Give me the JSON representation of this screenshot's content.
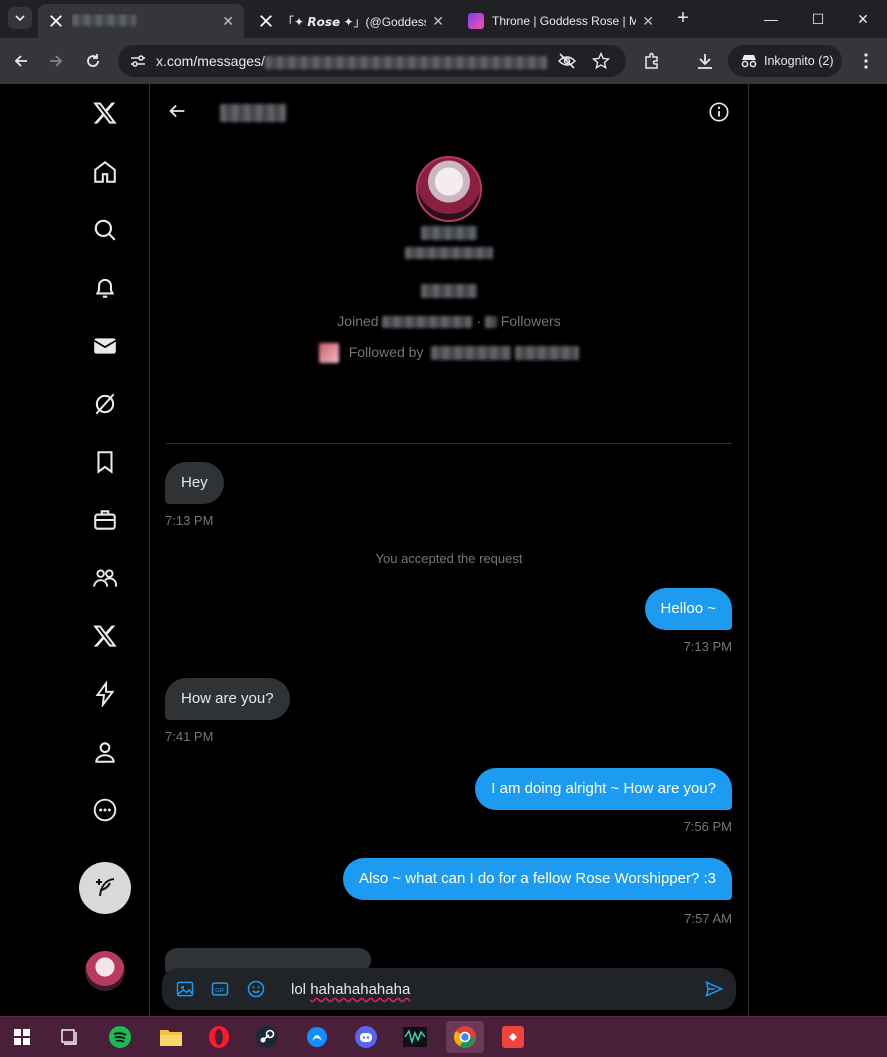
{
  "browser": {
    "tabs": [
      {
        "title": "",
        "active": true
      },
      {
        "title": "「✦ 𝙍𝙤𝙨𝙚 ✦」(@Goddess",
        "active": false
      },
      {
        "title": "Throne | Goddess Rose | M",
        "active": false
      }
    ],
    "url": "x.com/messages/",
    "incognito_label": "Inkognito (2)"
  },
  "sidebar": {
    "items": [
      "x-logo",
      "home",
      "explore",
      "notifications",
      "messages",
      "grok",
      "bookmarks",
      "jobs",
      "communities",
      "premium",
      "verified-orgs",
      "profile",
      "more"
    ]
  },
  "profile": {
    "joined_label": "Joined",
    "followers_label": "Followers",
    "followed_by_label": "Followed by"
  },
  "messages": [
    {
      "dir": "in",
      "text": "Hey",
      "time": "7:13 PM"
    },
    {
      "dir": "system",
      "text": "You accepted the request"
    },
    {
      "dir": "out",
      "text": "Helloo ~",
      "time": "7:13 PM"
    },
    {
      "dir": "in",
      "text": "How are you?",
      "time": "7:41 PM"
    },
    {
      "dir": "out",
      "text": "I am doing alright ~ How are you?",
      "time": "7:56 PM"
    },
    {
      "dir": "out",
      "text": "Also ~ what can I do for a fellow Rose Worshipper? :3",
      "time": "7:57 AM"
    }
  ],
  "composer": {
    "text_plain": "lol ",
    "text_underlined": "hahahahahaha"
  },
  "colors": {
    "accent": "#1d9bf0",
    "incoming_bubble": "#2f3336",
    "taskbar": "#4a1f3a"
  }
}
